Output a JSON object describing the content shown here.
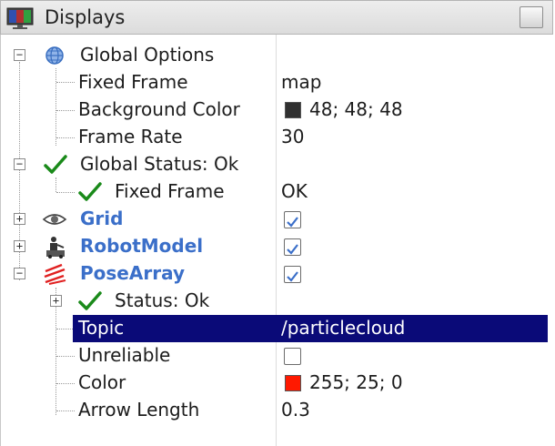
{
  "window": {
    "title": "Displays"
  },
  "colors": {
    "selection": "#0a0a78",
    "display_label": "#3b6fc9",
    "status_ok": "#1a8a1a",
    "background_color_swatch": "#303030",
    "pose_array_color_swatch": "#ff1900"
  },
  "tree": {
    "global_options": {
      "label": "Global Options",
      "icon": "globe-icon",
      "fixed_frame": {
        "label": "Fixed Frame",
        "value": "map"
      },
      "background_color": {
        "label": "Background Color",
        "value": "48; 48; 48"
      },
      "frame_rate": {
        "label": "Frame Rate",
        "value": "30"
      }
    },
    "global_status": {
      "label": "Global Status: Ok",
      "icon": "checkmark-icon",
      "fixed_frame": {
        "label": "Fixed Frame",
        "value": "OK"
      }
    },
    "grid": {
      "label": "Grid",
      "icon": "grid-eye-icon",
      "enabled": true
    },
    "robot_model": {
      "label": "RobotModel",
      "icon": "robot-icon",
      "enabled": true
    },
    "pose_array": {
      "label": "PoseArray",
      "icon": "pose-array-icon",
      "enabled": true,
      "status": {
        "label": "Status: Ok"
      },
      "topic": {
        "label": "Topic",
        "value": "/particlecloud"
      },
      "unreliable": {
        "label": "Unreliable",
        "checked": false
      },
      "color": {
        "label": "Color",
        "value": "255; 25; 0"
      },
      "arrow_length": {
        "label": "Arrow Length",
        "value": "0.3"
      }
    }
  }
}
